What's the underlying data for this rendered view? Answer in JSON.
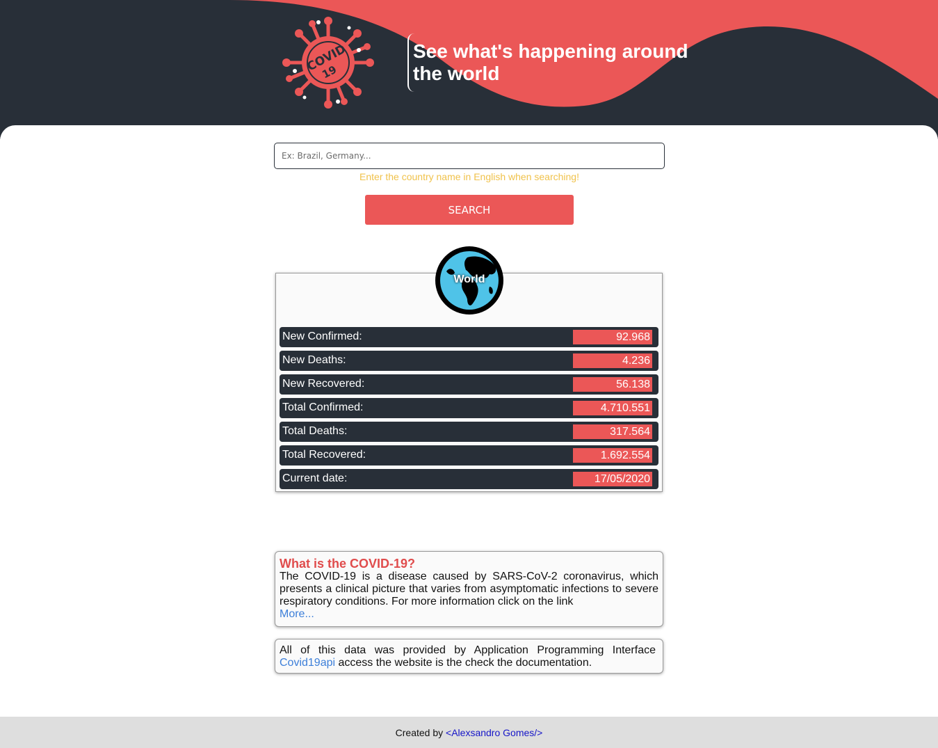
{
  "header": {
    "logo_text": "COVID-19",
    "tagline": "See what's happening around the world"
  },
  "search": {
    "placeholder": "Ex: Brazil, Germany...",
    "hint": "Enter the country name in English when searching!",
    "button_label": "SEARCH"
  },
  "world": {
    "label": "World",
    "stats": [
      {
        "label": "New Confirmed:",
        "value": "92.968"
      },
      {
        "label": "New Deaths:",
        "value": "4.236"
      },
      {
        "label": "New Recovered:",
        "value": "56.138"
      },
      {
        "label": "Total Confirmed:",
        "value": "4.710.551"
      },
      {
        "label": "Total Deaths:",
        "value": "317.564"
      },
      {
        "label": "Total Recovered:",
        "value": "1.692.554"
      },
      {
        "label": "Current date:",
        "value": "17/05/2020"
      }
    ]
  },
  "info": {
    "title": "What is the COVID-19?",
    "body": "The COVID-19 is a disease caused by SARS-CoV-2 coronavirus, which presents a clinical picture that varies from asymptomatic infections to severe respiratory conditions. For more information click on the link",
    "more_link": "More..."
  },
  "api": {
    "text_before": "All of this data was provided by Application Programming Interface",
    "link_label": "Covid19api",
    "text_after": " access the website is the check the documentation."
  },
  "footer": {
    "prefix": "Created by ",
    "author_link": "<Alexsandro Gomes/>"
  },
  "colors": {
    "dark": "#282f38",
    "accent": "#eb5757",
    "hint": "#f0c24b",
    "link": "#3d7fd9"
  }
}
